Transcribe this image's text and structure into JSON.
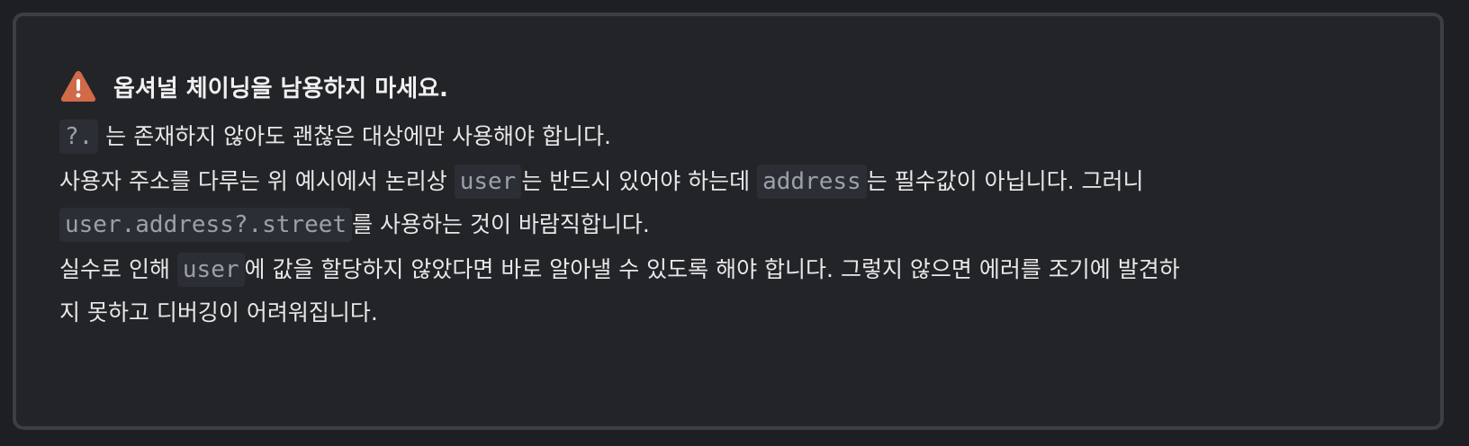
{
  "callout": {
    "type": "warning",
    "icon": "warning-triangle-icon",
    "icon_color": "#d06a49",
    "title": "옵셔널 체이닝을 남용하지 마세요.",
    "p1": {
      "code1": "?.",
      "text1": " 는 존재하지 않아도 괜찮은 대상에만 사용해야 합니다."
    },
    "p2": {
      "text1": "사용자 주소를 다루는 위 예시에서 논리상 ",
      "code1": "user",
      "text2": "는 반드시 있어야 하는데 ",
      "code2": "address",
      "text3": "는 필수값이 아닙니다. 그러니",
      "code3": "user.address?.street",
      "text4": "를 사용하는 것이 바람직합니다."
    },
    "p3": {
      "text1": "실수로 인해 ",
      "code1": "user",
      "text2": "에 값을 할당하지 않았다면 바로 알아낼 수 있도록 해야 합니다. 그렇지 않으면 에러를 조기에 발견하",
      "text3": "지 못하고 디버깅이 어려워집니다."
    }
  }
}
